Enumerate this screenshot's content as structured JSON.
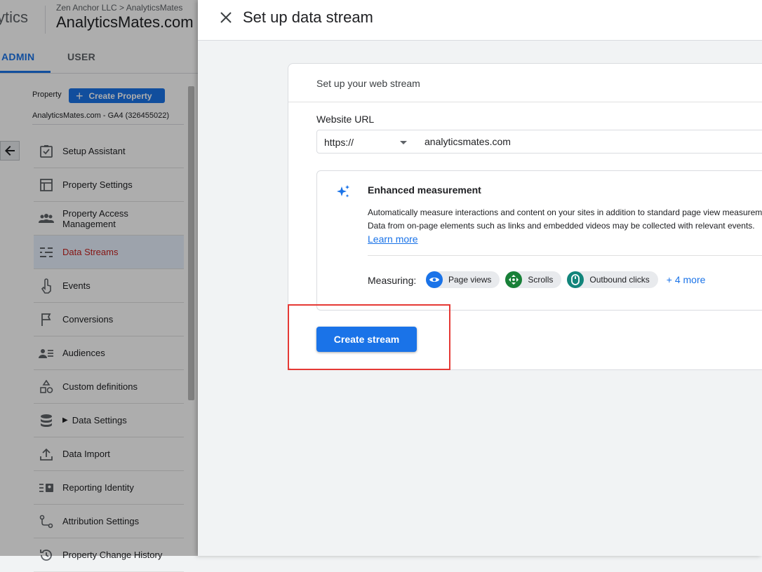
{
  "app": {
    "brand_fragment": "ytics",
    "account_path": "Zen Anchor LLC > AnalyticsMates",
    "account_name": "AnalyticsMates.com"
  },
  "tabs": [
    {
      "label": "ADMIN",
      "active": true
    },
    {
      "label": "USER",
      "active": false
    }
  ],
  "property": {
    "label": "Property",
    "create_label": "Create Property",
    "selected": "AnalyticsMates.com - GA4 (326455022)"
  },
  "nav": [
    {
      "label": "Setup Assistant",
      "icon": "checkbox-icon"
    },
    {
      "label": "Property Settings",
      "icon": "layout-icon"
    },
    {
      "label": "Property Access Management",
      "icon": "people-icon"
    },
    {
      "label": "Data Streams",
      "icon": "streams-icon",
      "active": true
    },
    {
      "label": "Events",
      "icon": "touch-icon"
    },
    {
      "label": "Conversions",
      "icon": "flag-icon"
    },
    {
      "label": "Audiences",
      "icon": "audience-icon"
    },
    {
      "label": "Custom definitions",
      "icon": "shapes-icon"
    },
    {
      "label": "Data Settings",
      "icon": "database-icon",
      "expandable": true
    },
    {
      "label": "Data Import",
      "icon": "upload-icon"
    },
    {
      "label": "Reporting Identity",
      "icon": "identity-icon"
    },
    {
      "label": "Attribution Settings",
      "icon": "attribution-icon"
    },
    {
      "label": "Property Change History",
      "icon": "history-icon"
    }
  ],
  "drawer": {
    "title": "Set up data stream",
    "card_title": "Set up your web stream",
    "url_label": "Website URL",
    "protocol": "https://",
    "url_value": "analyticsmates.com",
    "enhanced": {
      "title": "Enhanced measurement",
      "desc1": "Automatically measure interactions and content on your sites in addition to standard page view measurement.",
      "desc2": "Data from on-page elements such as links and embedded videos may be collected with relevant events.",
      "learn_more": "Learn more",
      "measuring_label": "Measuring:",
      "chips": [
        {
          "label": "Page views",
          "icon": "eye-icon",
          "color": "#1a73e8"
        },
        {
          "label": "Scrolls",
          "icon": "scroll-icon",
          "color": "#188038"
        },
        {
          "label": "Outbound clicks",
          "icon": "mouse-icon",
          "color": "#12857b"
        }
      ],
      "more": "+ 4 more"
    },
    "create_button": "Create stream"
  },
  "colors": {
    "accent": "#1a73e8",
    "highlight": "#e53935"
  }
}
